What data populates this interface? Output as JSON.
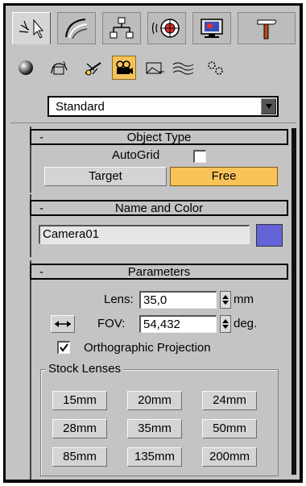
{
  "toolbar_tabs": [
    {
      "icon": "arrow-pointer-icon",
      "active": true
    },
    {
      "icon": "modify-curve-icon",
      "active": false
    },
    {
      "icon": "hierarchy-icon",
      "active": false
    },
    {
      "icon": "motion-icon",
      "active": false
    },
    {
      "icon": "display-monitor-icon",
      "active": false
    },
    {
      "icon": "utilities-hammer-icon",
      "active": false
    }
  ],
  "category_icons": [
    {
      "icon": "geometry-sphere-icon",
      "active": false
    },
    {
      "icon": "shapes-icon",
      "active": false
    },
    {
      "icon": "lights-icon",
      "active": false
    },
    {
      "icon": "cameras-icon",
      "active": true
    },
    {
      "icon": "helpers-icon",
      "active": false
    },
    {
      "icon": "space-warps-icon",
      "active": false
    },
    {
      "icon": "systems-icon",
      "active": false
    }
  ],
  "dropdown": {
    "value": "Standard"
  },
  "object_type": {
    "title": "Object Type",
    "collapse": "-",
    "autogrid_label": "AutoGrid",
    "autogrid_checked": false,
    "buttons": [
      {
        "label": "Target",
        "active": false
      },
      {
        "label": "Free",
        "active": true
      }
    ]
  },
  "name_color": {
    "title": "Name and Color",
    "collapse": "-",
    "name_value": "Camera01",
    "color": "#6464d8"
  },
  "parameters": {
    "title": "Parameters",
    "collapse": "-",
    "lens_label": "Lens:",
    "lens_value": "35,0",
    "lens_unit": "mm",
    "fov_label": "FOV:",
    "fov_value": "54,432",
    "fov_unit": "deg.",
    "ortho_label": "Orthographic Projection",
    "ortho_checked": true,
    "stock_title": "Stock Lenses",
    "lenses": [
      "15mm",
      "20mm",
      "24mm",
      "28mm",
      "35mm",
      "50mm",
      "85mm",
      "135mm",
      "200mm"
    ]
  },
  "colors": {
    "panel_bg": "#c4c4c4",
    "active_accent": "#f9c35a",
    "border_dark": "#000000"
  }
}
